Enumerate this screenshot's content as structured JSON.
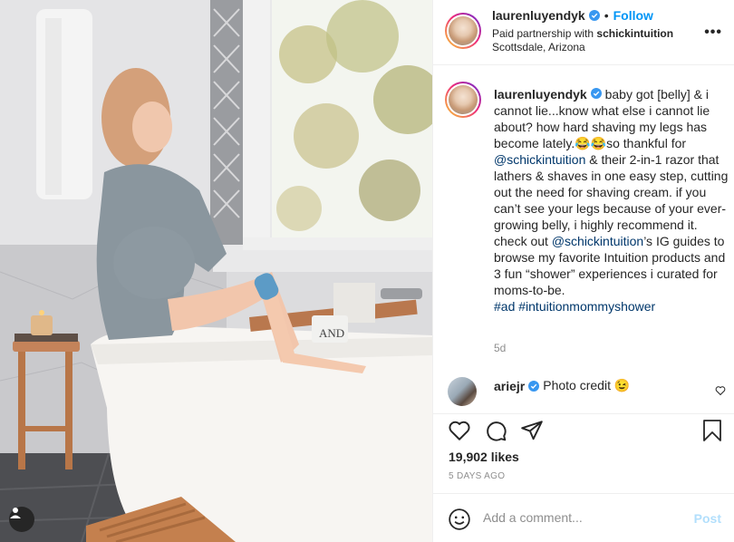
{
  "post": {
    "author": "laurenluyendyk",
    "follow_label": "Follow",
    "dot": "•",
    "paid_partnership_prefix": "Paid partnership with ",
    "partner": "schickintuition",
    "location": "Scottsdale, Arizona",
    "more_label": "•••"
  },
  "caption": {
    "username": "laurenluyendyk",
    "text_1": " baby got [belly] & i cannot lie...know what else i cannot lie about? how hard shaving my legs has become lately.😂😂so thankful for ",
    "mention_1": "@schickintuition",
    "text_2": " & their 2-in-1 razor that lathers & shaves in one easy step, cutting out the need for shaving cream. if you can’t see your legs because of your ever-growing belly, i highly recommend it. check out ",
    "mention_2": "@schickintuition",
    "text_3": "’s IG guides to browse my favorite Intuition products and 3 fun “shower” experiences i curated for moms-to-be.",
    "hashtag_1": "#ad",
    "hashtag_2": "#intuitionmommyshower",
    "age": "5d"
  },
  "comment": {
    "username": "ariejr",
    "text": "Photo credit 😉"
  },
  "stats": {
    "likes": "19,902 likes",
    "date": "5 DAYS AGO"
  },
  "add_comment": {
    "placeholder": "Add a comment...",
    "post_label": "Post"
  },
  "photo": {
    "product_text": "AND"
  },
  "colors": {
    "link_blue": "#0095f6",
    "mention_blue": "#00376b",
    "verified_blue": "#3897f0",
    "post_disabled": "#b2dffc"
  }
}
